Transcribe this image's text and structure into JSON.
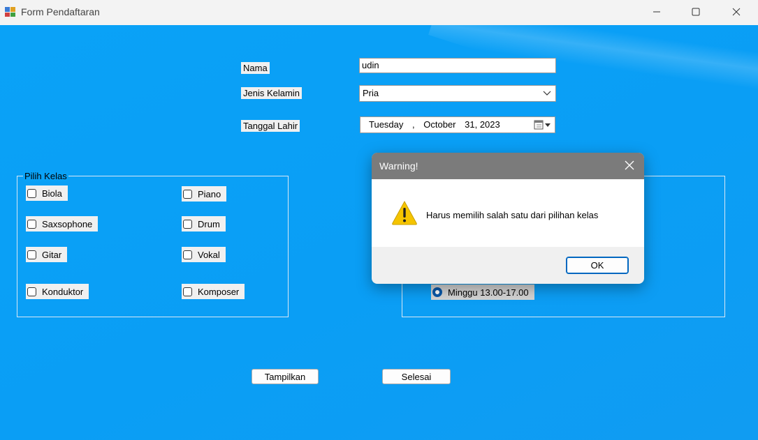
{
  "window": {
    "title": "Form Pendaftaran",
    "icon": "form-app-icon",
    "controls": [
      "minimize-icon",
      "maximize-icon",
      "close-icon"
    ]
  },
  "form": {
    "nama_label": "Nama",
    "nama_value": "udin",
    "jenis_kelamin_label": "Jenis Kelamin",
    "jenis_kelamin_value": "Pria",
    "tanggal_lahir_label": "Tanggal Lahir",
    "date": {
      "day_name": "Tuesday",
      "separator": ",",
      "month": "October",
      "day_year": "31, 2023"
    }
  },
  "pilih_kelas": {
    "title": "Pilih Kelas",
    "items": [
      "Biola",
      "Piano",
      "Saxsophone",
      "Drum",
      "Gitar",
      "Vokal",
      "Konduktor",
      "Komposer"
    ]
  },
  "jadwal": {
    "visible_option": "Minggu 13.00-17.00",
    "selected": true
  },
  "buttons": {
    "tampilkan": "Tampilkan",
    "selesai": "Selesai"
  },
  "dialog": {
    "title": "Warning!",
    "message": "Harus memilih salah satu dari pilihan kelas",
    "ok_label": "OK",
    "icon": "warning-icon"
  },
  "colors": {
    "client_background": "#0aa2f7",
    "dialog_titlebar": "#7b7b7b",
    "accent": "#0067c0",
    "warning": "#f5c400"
  }
}
